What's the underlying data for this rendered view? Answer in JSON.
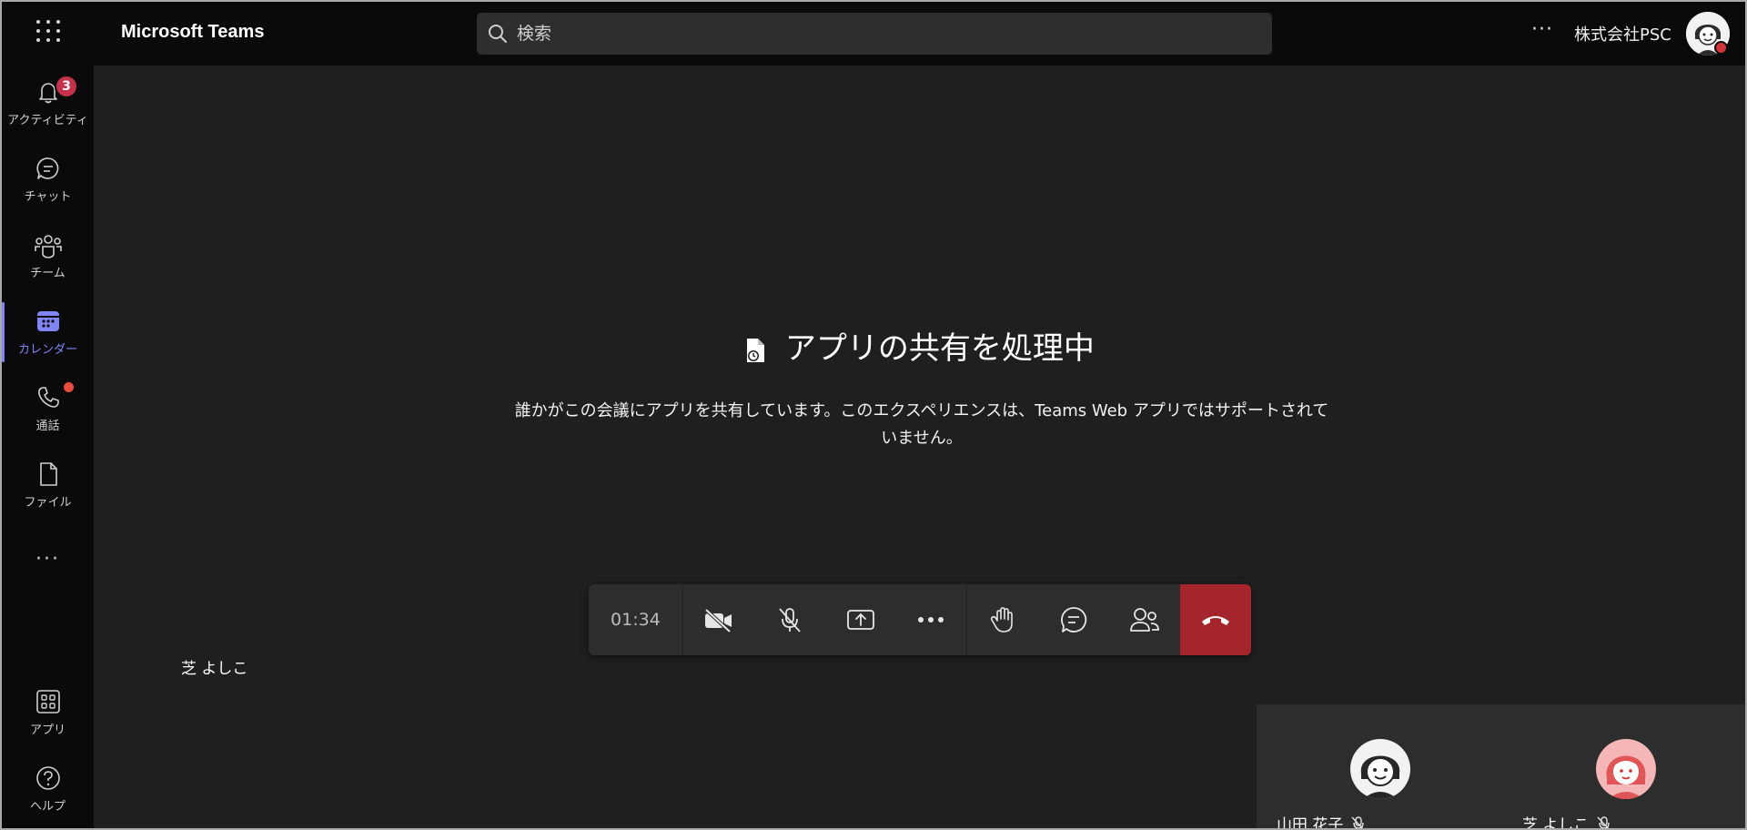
{
  "app": {
    "title": "Microsoft Teams"
  },
  "search": {
    "placeholder": "検索"
  },
  "header": {
    "more": "···",
    "org": "株式会社PSC"
  },
  "rail": {
    "items": [
      {
        "label": "アクティビティ",
        "badge": "3"
      },
      {
        "label": "チャット"
      },
      {
        "label": "チーム"
      },
      {
        "label": "カレンダー",
        "active": true
      },
      {
        "label": "通話"
      },
      {
        "label": "ファイル"
      },
      {
        "label": "アプリ"
      },
      {
        "label": "ヘルプ"
      }
    ],
    "more": "···"
  },
  "main": {
    "title": "アプリの共有を処理中",
    "description": "誰かがこの会議にアプリを共有しています。このエクスペリエンスは、Teams Web アプリではサポートされていません。"
  },
  "controls": {
    "timer": "01:34"
  },
  "stage": {
    "presenter_label": "芝 よしこ"
  },
  "participants": [
    {
      "name": "山田 花子"
    },
    {
      "name": "芝 よしこ"
    }
  ],
  "colors": {
    "accent": "#7f85f5",
    "hangup": "#a4262c",
    "badge": "#c4314b"
  }
}
